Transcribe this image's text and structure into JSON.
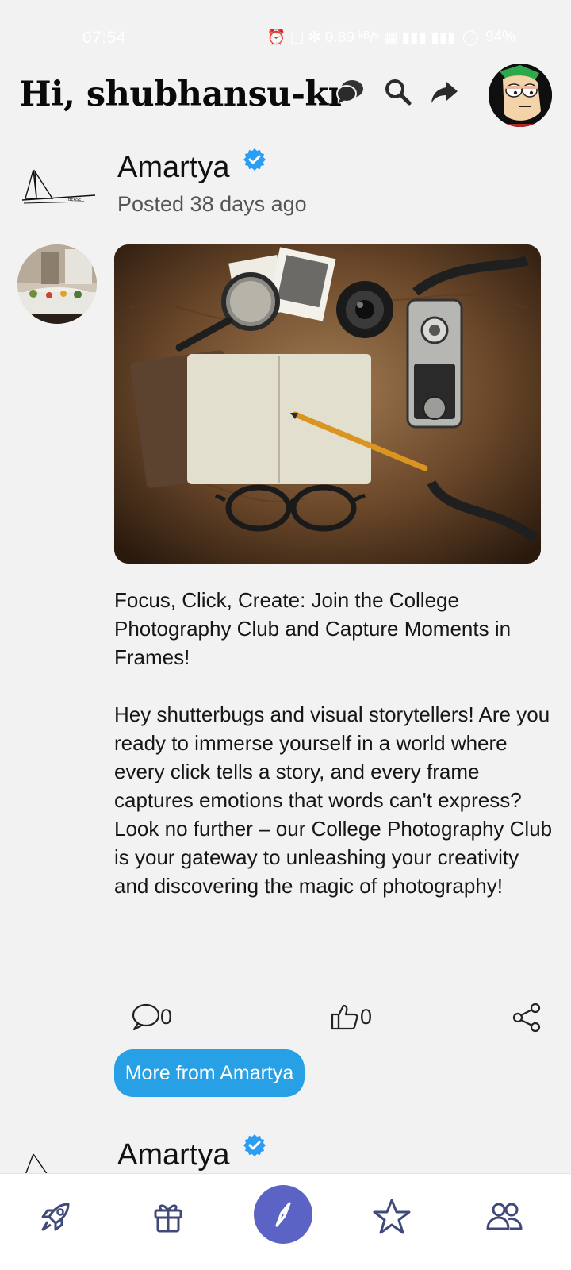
{
  "status_bar": {
    "time": "07:54",
    "indicators": "⏰ ◫ ✻ 0.89 ᵏᴮ/ˢ ▦ ▮▮▮ ▮▮▮",
    "battery": "94%"
  },
  "header": {
    "greeting": "Hi, shubhansu-kr",
    "icons": [
      "chat-icon",
      "search-icon",
      "share-arrow-icon"
    ],
    "avatar": "user-avatar"
  },
  "post": {
    "author": "Amartya",
    "verified": true,
    "posted": "Posted 38 days ago",
    "logo_text": "BEASE",
    "body": " Focus, Click, Create: Join the College Photography Club and Capture Moments in Frames!\n\nHey shutterbugs and visual storytellers! Are you ready to immerse yourself in a world where every click tells a story, and every frame captures emotions that words can't express? Look no further – our College Photography Club is your gateway to unleashing your creativity and discovering the magic of photography!",
    "comments": "0",
    "likes": "0",
    "more_button": "More from Amartya"
  },
  "post2": {
    "author": "Amartya",
    "verified": true
  },
  "bottom_nav": {
    "items": [
      "rocket-icon",
      "gift-icon",
      "compass-icon",
      "star-icon",
      "people-icon"
    ],
    "active": "compass-icon"
  },
  "colors": {
    "accent": "#27a0e5",
    "nav_active": "#5b63c4",
    "icon": "#3f4a7a",
    "verified": "#2a9df4"
  }
}
